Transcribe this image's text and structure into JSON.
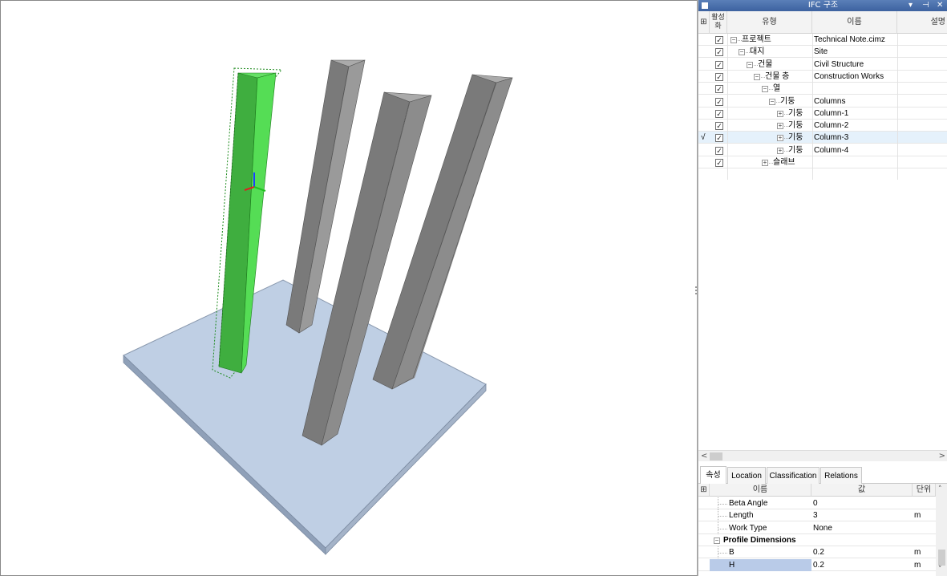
{
  "viewport": {
    "slab_color": "#bfcfe4",
    "selected_color": "#4fd64f",
    "column_color": "#7f7f7f"
  },
  "panel": {
    "title": "IFC 구조",
    "controls": [
      "▾",
      "⊣",
      "✕"
    ]
  },
  "tree": {
    "headers": {
      "active": "활성화",
      "type": "유형",
      "name": "이름",
      "desc": "설명"
    },
    "rows": [
      {
        "type": "프로젝트",
        "name": "Technical Note.cimz",
        "level": 0,
        "expander": "−",
        "marker": ""
      },
      {
        "type": "대지",
        "name": "Site",
        "level": 1,
        "expander": "−",
        "marker": ""
      },
      {
        "type": "건물",
        "name": "Civil Structure",
        "level": 2,
        "expander": "−",
        "marker": ""
      },
      {
        "type": "건물 층",
        "name": "Construction Works",
        "level": 3,
        "expander": "−",
        "marker": ""
      },
      {
        "type": "열",
        "name": "",
        "level": 4,
        "expander": "−",
        "marker": ""
      },
      {
        "type": "기둥",
        "name": "Columns",
        "level": 5,
        "expander": "−",
        "marker": ""
      },
      {
        "type": "기둥",
        "name": "Column-1",
        "level": 6,
        "expander": "+",
        "marker": ""
      },
      {
        "type": "기둥",
        "name": "Column-2",
        "level": 6,
        "expander": "+",
        "marker": ""
      },
      {
        "type": "기둥",
        "name": "Column-3",
        "level": 6,
        "expander": "+",
        "marker": "√",
        "selected": true
      },
      {
        "type": "기둥",
        "name": "Column-4",
        "level": 6,
        "expander": "+",
        "marker": ""
      },
      {
        "type": "슬래브",
        "name": "",
        "level": 4,
        "expander": "+",
        "marker": ""
      }
    ],
    "checkmark": "✓"
  },
  "scroll": {
    "left": "<",
    "right": ">"
  },
  "tabs": [
    {
      "label": "속성",
      "active": true
    },
    {
      "label": "Location",
      "active": false
    },
    {
      "label": "Classification",
      "active": false
    },
    {
      "label": "Relations",
      "active": false
    }
  ],
  "props": {
    "headers": {
      "name": "이름",
      "value": "값",
      "unit": "단위"
    },
    "rows": [
      {
        "name": "Beta Angle",
        "value": "0",
        "unit": "",
        "group": false
      },
      {
        "name": "Length",
        "value": "3",
        "unit": "m",
        "group": false
      },
      {
        "name": "Work Type",
        "value": "None",
        "unit": "",
        "group": false
      },
      {
        "name": "Profile Dimensions",
        "value": "",
        "unit": "",
        "group": true,
        "expander": "−"
      },
      {
        "name": "B",
        "value": "0.2",
        "unit": "m",
        "group": false
      },
      {
        "name": "H",
        "value": "0.2",
        "unit": "m",
        "group": false,
        "selected": true
      }
    ]
  }
}
